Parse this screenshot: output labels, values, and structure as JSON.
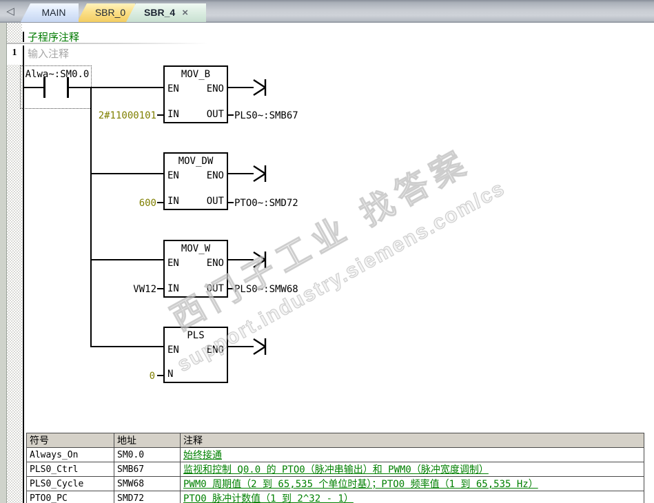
{
  "tabs": {
    "nav_back_icon": "◁",
    "items": [
      {
        "label": "MAIN"
      },
      {
        "label": "SBR_0"
      },
      {
        "label": "SBR_4",
        "close_icon": "×"
      }
    ]
  },
  "editor": {
    "program_comment": "子程序注释",
    "network_number": "1",
    "network_comment": "输入注释",
    "contact": {
      "label": "Alwa~:SM0.0"
    },
    "blocks": [
      {
        "title": "MOV_B",
        "en": "EN",
        "eno": "ENO",
        "in_label": "IN",
        "out_label": "OUT",
        "in_value": "2#11000101",
        "out_value": "PLS0~:SMB67"
      },
      {
        "title": "MOV_DW",
        "en": "EN",
        "eno": "ENO",
        "in_label": "IN",
        "out_label": "OUT",
        "in_value": "600",
        "out_value": "PTO0~:SMD72"
      },
      {
        "title": "MOV_W",
        "en": "EN",
        "eno": "ENO",
        "in_label": "IN",
        "out_label": "OUT",
        "in_value": "VW12",
        "out_value": "PLS0~:SMW68"
      },
      {
        "title": "PLS",
        "en": "EN",
        "eno": "ENO",
        "in_label": "N",
        "in_value": "0"
      }
    ]
  },
  "watermark": {
    "line1": "西门子工业 找答案",
    "line2": "support.industry.siemens.com/cs"
  },
  "symbol_table": {
    "headers": [
      "符号",
      "地址",
      "注释"
    ],
    "rows": [
      {
        "symbol": "Always_On",
        "address": "SM0.0",
        "comment": "始终接通"
      },
      {
        "symbol": "PLS0_Ctrl",
        "address": "SMB67",
        "comment": "监视和控制 Q0.0 的 PTO0（脉冲串输出）和 PWM0（脉冲宽度调制）"
      },
      {
        "symbol": "PLS0_Cycle",
        "address": "SMW68",
        "comment": "PWM0 周期值（2 到 65,535 个单位时基）；PTO0 频率值（1 到 65,535 Hz）"
      },
      {
        "symbol": "PTO0_PC",
        "address": "SMD72",
        "comment": "PTO0 脉冲计数值（1 到 2^32 - 1）"
      }
    ]
  },
  "colors": {
    "constant_operand": "#7f7f00",
    "comment_green": "#008000",
    "program_comment_green": "#007a00",
    "tab_main_bg": "#dde9fb",
    "tab_sbr0_bg": "#fbe089",
    "tab_sbr4_bg": "#ddeee3"
  }
}
